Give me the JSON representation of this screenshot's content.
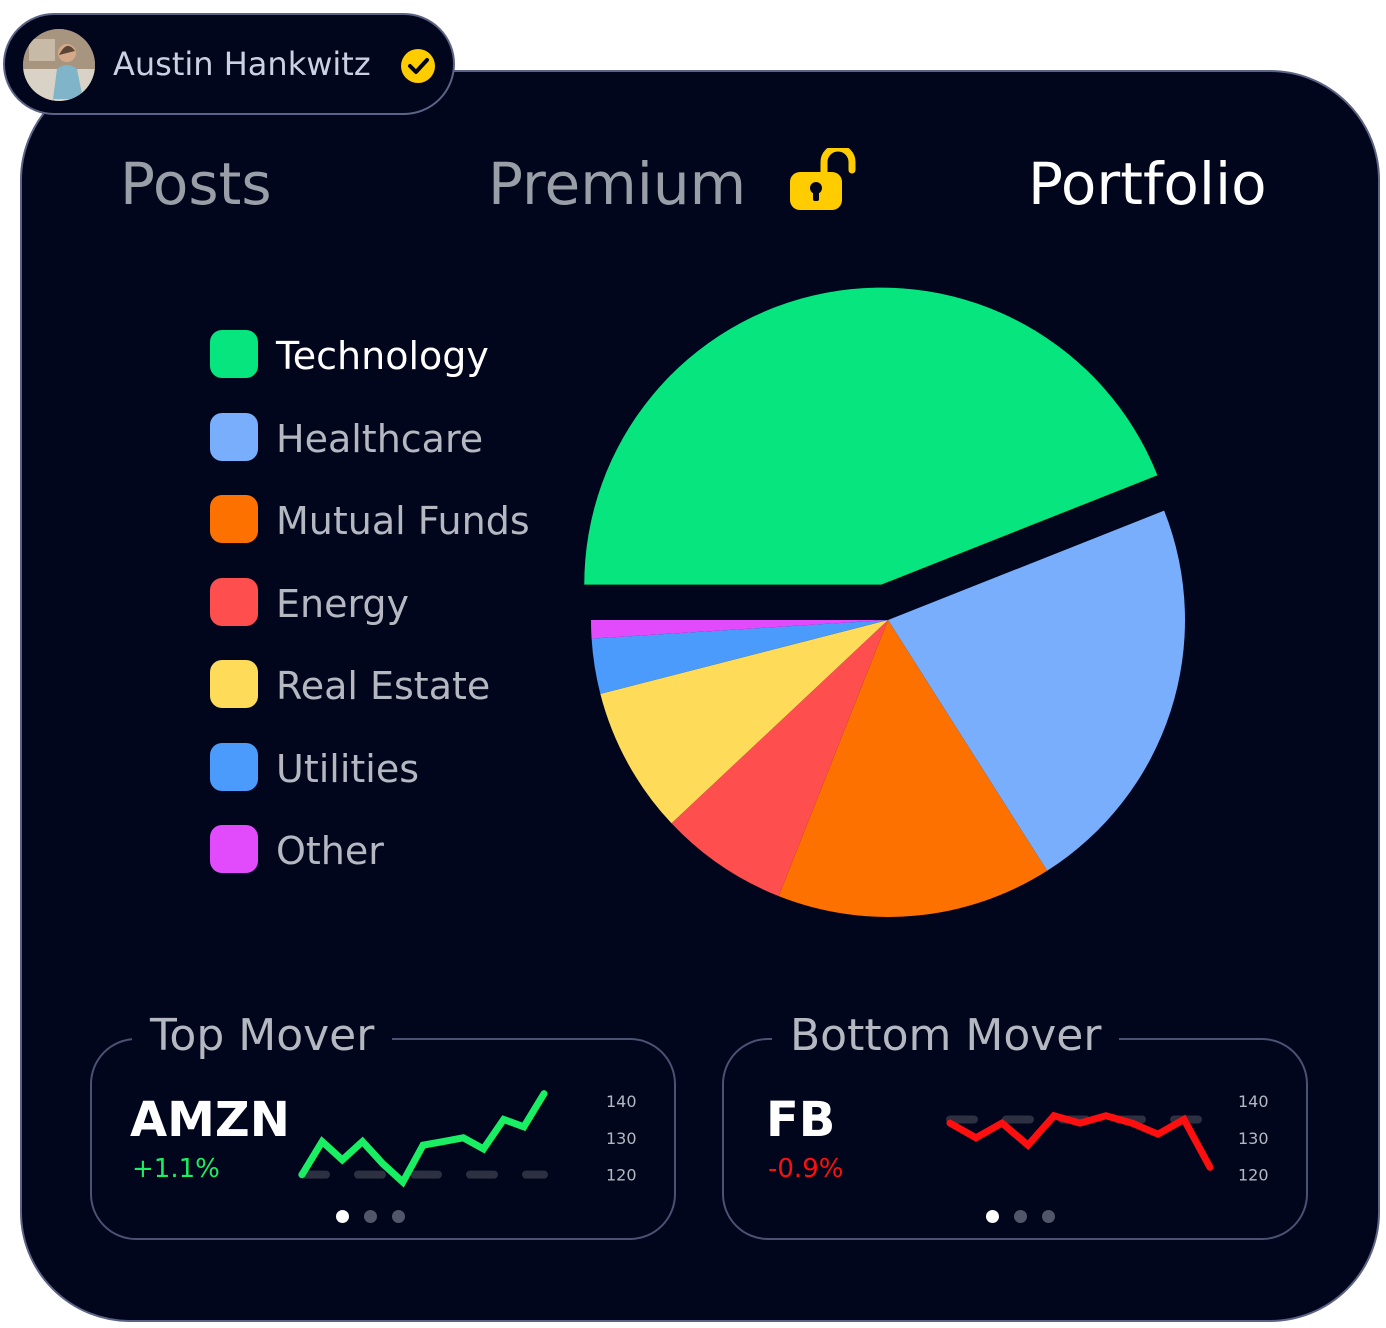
{
  "user": {
    "name": "Austin Hankwitz",
    "verified": true,
    "avatar": "avatar-photo"
  },
  "tabs": [
    {
      "label": "Posts",
      "active": false
    },
    {
      "label": "Premium",
      "active": false,
      "icon": "unlocked-padlock-icon",
      "icon_color": "#ffcc00"
    },
    {
      "label": "Portfolio",
      "active": true
    }
  ],
  "chart_data": {
    "type": "pie",
    "categories": [
      "Technology",
      "Healthcare",
      "Mutual Funds",
      "Energy",
      "Real Estate",
      "Utilities",
      "Other"
    ],
    "values": [
      44,
      22,
      15,
      7,
      8,
      3,
      1
    ],
    "colors": [
      "#07e57e",
      "#78aefc",
      "#fd7100",
      "#fe4e4e",
      "#fedc5a",
      "#4a9bfc",
      "#e24bfc"
    ],
    "exploded": [
      "Technology"
    ],
    "legend_placement": "left"
  },
  "top_mover": {
    "title": "Top Mover",
    "ticker": "AMZN",
    "change": "+1.1%",
    "change_color": "#1aee63",
    "y_ticks": [
      "140",
      "130",
      "120"
    ],
    "ylim": [
      118,
      143
    ],
    "reference_value": 120,
    "series": [
      120,
      129,
      124,
      129,
      123,
      118,
      128,
      129,
      130,
      127,
      135,
      133,
      142
    ],
    "page_dots": {
      "count": 3,
      "active": 0
    }
  },
  "bottom_mover": {
    "title": "Bottom Mover",
    "ticker": "FB",
    "change": "-0.9%",
    "change_color": "#fe0f0f",
    "y_ticks": [
      "140",
      "130",
      "120"
    ],
    "ylim": [
      118,
      143
    ],
    "reference_value": 135,
    "series": [
      134,
      130,
      134,
      128,
      136,
      134,
      136,
      134,
      131,
      135,
      122
    ],
    "page_dots": {
      "count": 3,
      "active": 0
    }
  }
}
